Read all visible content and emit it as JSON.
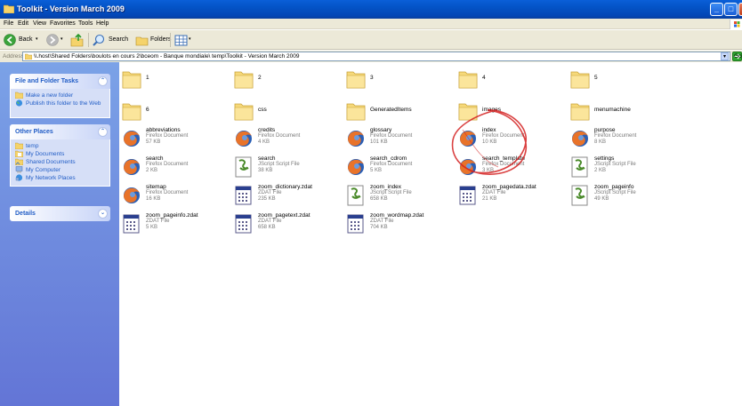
{
  "window": {
    "title": "Toolkit - Version March 2009"
  },
  "menubar": {
    "items": [
      "File",
      "Edit",
      "View",
      "Favorites",
      "Tools",
      "Help"
    ]
  },
  "toolbar": {
    "back_label": "Back",
    "search_label": "Search",
    "folders_label": "Folders"
  },
  "address": {
    "label": "Address",
    "path": "\\\\.host\\Shared Folders\\boulots en cours 2\\bceom - Banque mondiale\\  temp\\Toolkit - Version March 2009",
    "go_label": "Go"
  },
  "taskpane": {
    "file_tasks": {
      "title": "File and Folder Tasks",
      "items": [
        "Make a new folder",
        "Publish this folder to the Web"
      ]
    },
    "other_places": {
      "title": "Other Places",
      "items": [
        "temp",
        "My Documents",
        "Shared Documents",
        "My Computer",
        "My Network Places"
      ]
    },
    "details": {
      "title": "Details"
    }
  },
  "files": [
    {
      "name": "1",
      "type": "",
      "size": "",
      "kind": "folder"
    },
    {
      "name": "2",
      "type": "",
      "size": "",
      "kind": "folder"
    },
    {
      "name": "3",
      "type": "",
      "size": "",
      "kind": "folder"
    },
    {
      "name": "4",
      "type": "",
      "size": "",
      "kind": "folder"
    },
    {
      "name": "5",
      "type": "",
      "size": "",
      "kind": "folder"
    },
    {
      "name": "6",
      "type": "",
      "size": "",
      "kind": "folder"
    },
    {
      "name": "css",
      "type": "",
      "size": "",
      "kind": "folder"
    },
    {
      "name": "GeneratedItems",
      "type": "",
      "size": "",
      "kind": "folder"
    },
    {
      "name": "images",
      "type": "",
      "size": "",
      "kind": "folder"
    },
    {
      "name": "menumachine",
      "type": "",
      "size": "",
      "kind": "folder"
    },
    {
      "name": "abbreviations",
      "type": "Firefox Document",
      "size": "57 KB",
      "kind": "firefox"
    },
    {
      "name": "credits",
      "type": "Firefox Document",
      "size": "4 KB",
      "kind": "firefox"
    },
    {
      "name": "glossary",
      "type": "Firefox Document",
      "size": "101 KB",
      "kind": "firefox"
    },
    {
      "name": "index",
      "type": "Firefox Document",
      "size": "10 KB",
      "kind": "firefox"
    },
    {
      "name": "purpose",
      "type": "Firefox Document",
      "size": "8 KB",
      "kind": "firefox"
    },
    {
      "name": "search",
      "type": "Firefox Document",
      "size": "2 KB",
      "kind": "firefox"
    },
    {
      "name": "search",
      "type": "JScript Script File",
      "size": "38 KB",
      "kind": "script"
    },
    {
      "name": "search_cdrom",
      "type": "Firefox Document",
      "size": "5 KB",
      "kind": "firefox"
    },
    {
      "name": "search_template",
      "type": "Firefox Document",
      "size": "3 KB",
      "kind": "firefox"
    },
    {
      "name": "settings",
      "type": "JScript Script File",
      "size": "2 KB",
      "kind": "script"
    },
    {
      "name": "sitemap",
      "type": "Firefox Document",
      "size": "16 KB",
      "kind": "firefox"
    },
    {
      "name": "zoom_dictionary.zdat",
      "type": "ZDAT File",
      "size": "235 KB",
      "kind": "zdat"
    },
    {
      "name": "zoom_index",
      "type": "JScript Script File",
      "size": "658 KB",
      "kind": "script"
    },
    {
      "name": "zoom_pagedata.zdat",
      "type": "ZDAT File",
      "size": "21 KB",
      "kind": "zdat"
    },
    {
      "name": "zoom_pageinfo",
      "type": "JScript Script File",
      "size": "49 KB",
      "kind": "script"
    },
    {
      "name": "zoom_pageinfo.zdat",
      "type": "ZDAT File",
      "size": "5 KB",
      "kind": "zdat"
    },
    {
      "name": "zoom_pagetext.zdat",
      "type": "ZDAT File",
      "size": "658 KB",
      "kind": "zdat"
    },
    {
      "name": "zoom_wordmap.zdat",
      "type": "ZDAT File",
      "size": "704 KB",
      "kind": "zdat"
    }
  ],
  "colors": {
    "title_blue": "#0453c6",
    "taskpane_blue": "#7ba2e7",
    "annotation_red": "#d42020"
  }
}
